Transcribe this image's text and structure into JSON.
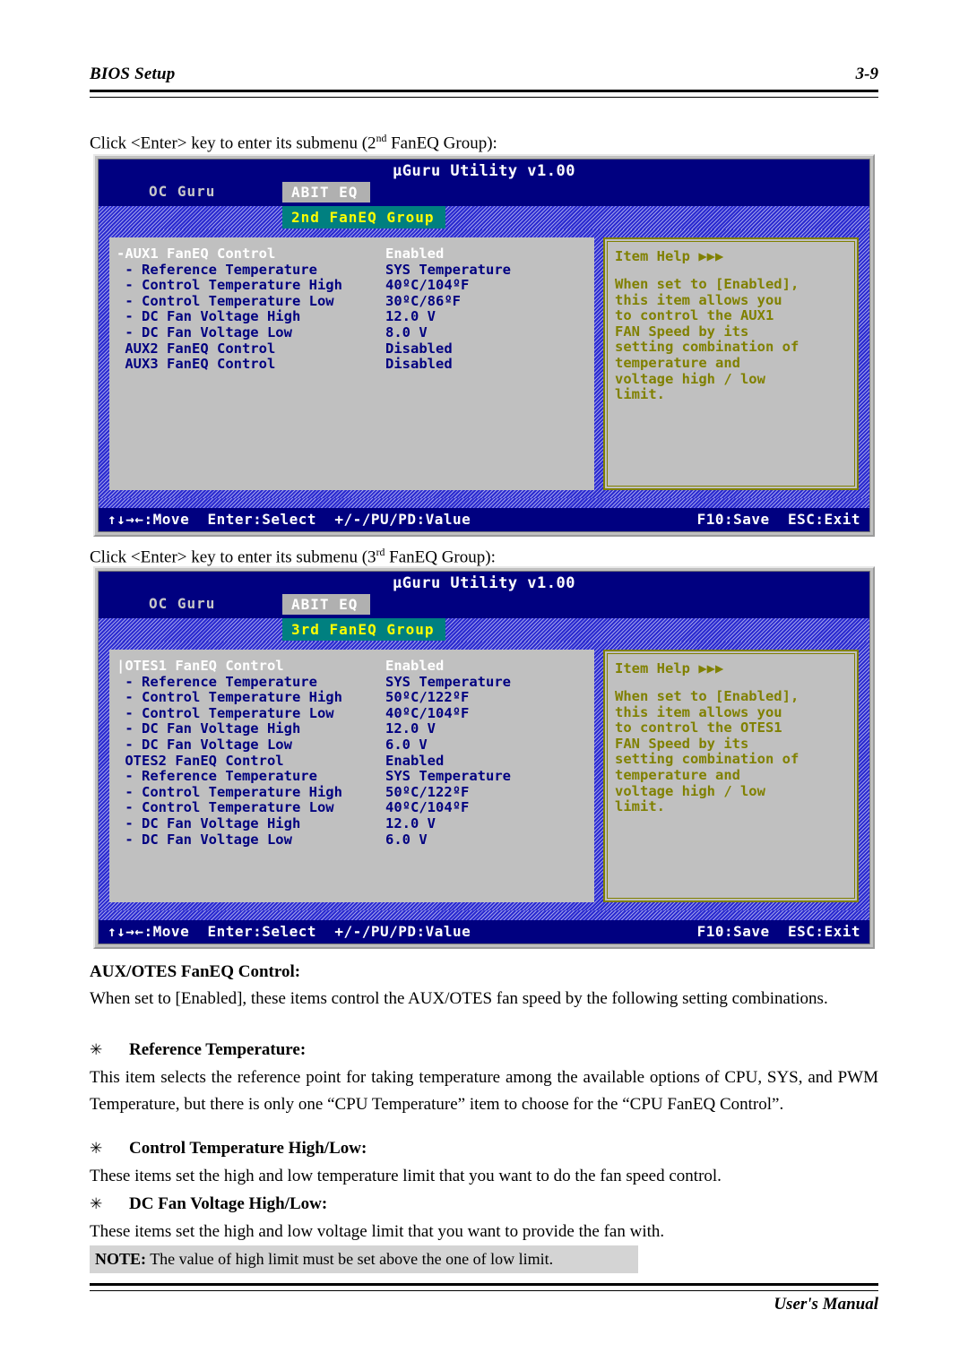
{
  "header": {
    "title": "BIOS Setup",
    "page_number": "3-9"
  },
  "footer": {
    "text": "User's Manual"
  },
  "intro_1": {
    "before": "Click <Enter> key to enter its submenu (2",
    "sup": "nd",
    "after": " FanEQ Group):"
  },
  "intro_2": {
    "before": "Click <Enter> key to enter its submenu (3",
    "sup": "rd",
    "after": " FanEQ Group):"
  },
  "bios_1": {
    "app_title": "µGuru Utility v1.00",
    "tab_ocguru": "OC Guru",
    "tab_abiteq": "ABIT EQ",
    "tab_group": "2nd FanEQ Group",
    "rows": [
      {
        "label": "-AUX1 FanEQ Control",
        "value": "Enabled",
        "selected": true
      },
      {
        "label": " - Reference Temperature",
        "value": "SYS Temperature",
        "selected": false
      },
      {
        "label": " - Control Temperature High",
        "value": "40ºC/104ºF",
        "selected": false
      },
      {
        "label": " - Control Temperature Low",
        "value": "30ºC/86ºF",
        "selected": false
      },
      {
        "label": " - DC Fan Voltage High",
        "value": "12.0 V",
        "selected": false
      },
      {
        "label": " - DC Fan Voltage Low",
        "value": "8.0 V",
        "selected": false
      },
      {
        "label": " AUX2 FanEQ Control",
        "value": "Disabled",
        "selected": false
      },
      {
        "label": " AUX3 FanEQ Control",
        "value": "Disabled",
        "selected": false
      }
    ],
    "help_title": "Item Help ▶▶▶",
    "help_lines": [
      "When set to [Enabled],",
      "this item allows you",
      "to control the AUX1",
      "FAN Speed by its",
      "setting combination of",
      "temperature and",
      "voltage high / low",
      "limit."
    ],
    "status_left": "↑↓→←:Move  Enter:Select  +/-/PU/PD:Value",
    "status_right": "F10:Save  ESC:Exit"
  },
  "bios_2": {
    "app_title": "µGuru Utility v1.00",
    "tab_ocguru": "OC Guru",
    "tab_abiteq": "ABIT EQ",
    "tab_group": "3rd FanEQ Group",
    "rows": [
      {
        "label": "|OTES1 FanEQ Control",
        "value": "Enabled",
        "selected": true
      },
      {
        "label": " - Reference Temperature",
        "value": "SYS Temperature",
        "selected": false
      },
      {
        "label": " - Control Temperature High",
        "value": "50ºC/122ºF",
        "selected": false
      },
      {
        "label": " - Control Temperature Low",
        "value": "40ºC/104ºF",
        "selected": false
      },
      {
        "label": " - DC Fan Voltage High",
        "value": "12.0 V",
        "selected": false
      },
      {
        "label": " - DC Fan Voltage Low",
        "value": "6.0 V",
        "selected": false
      },
      {
        "label": " OTES2 FanEQ Control",
        "value": "Enabled",
        "selected": false
      },
      {
        "label": " - Reference Temperature",
        "value": "SYS Temperature",
        "selected": false
      },
      {
        "label": " - Control Temperature High",
        "value": "50ºC/122ºF",
        "selected": false
      },
      {
        "label": " - Control Temperature Low",
        "value": "40ºC/104ºF",
        "selected": false
      },
      {
        "label": " - DC Fan Voltage High",
        "value": "12.0 V",
        "selected": false
      },
      {
        "label": " - DC Fan Voltage Low",
        "value": "6.0 V",
        "selected": false
      }
    ],
    "help_title": "Item Help ▶▶▶",
    "help_lines": [
      "When set to [Enabled],",
      "this item allows you",
      "to control the OTES1",
      "FAN Speed by its",
      "setting combination of",
      "temperature and",
      "voltage high / low",
      "limit."
    ],
    "status_left": "↑↓→←:Move  Enter:Select  +/-/PU/PD:Value",
    "status_right": "F10:Save  ESC:Exit"
  },
  "sections": {
    "aux_otes_heading": "AUX/OTES FanEQ Control:",
    "aux_otes_body": "When set to [Enabled], these items control the AUX/OTES fan speed by the following setting combinations.",
    "bullet_mark": "✳",
    "ref_temp_heading": "Reference Temperature:",
    "ref_temp_body": "This item selects the reference point for taking temperature among the available options of CPU, SYS, and PWM Temperature, but there is only one “CPU Temperature” item to choose for the “CPU FanEQ Control”.",
    "ctrl_temp_heading": "Control Temperature High/Low:",
    "ctrl_temp_body": "These items set the high and low temperature limit that you want to do the fan speed control.",
    "dc_fan_heading": "DC Fan Voltage High/Low:",
    "dc_fan_body": "These items set the high and low voltage limit that you want to provide the fan with.",
    "note_label": "NOTE:",
    "note_text": " The value of high limit must be set above the one of low limit."
  },
  "colors": {
    "titlebar": "#000080",
    "hatch_blue": "#2a2ad0",
    "panel_gray": "#c0c0c0",
    "tab_active": "#008080",
    "tab_active_text": "#ffff00",
    "help_olive": "#808000",
    "item_navy": "#000080",
    "selected_white": "#ffffff"
  }
}
